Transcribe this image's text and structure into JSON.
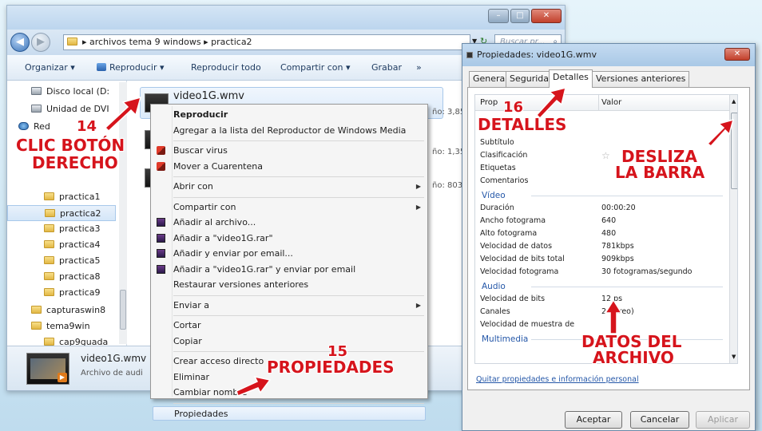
{
  "explorer": {
    "address": [
      "archivos tema 9 windows",
      "practica2"
    ],
    "search_placeholder": "Buscar pr...",
    "toolbar": [
      "Organizar ▾",
      "Reproducir ▾",
      "Reproducir todo",
      "Compartir con ▾",
      "Grabar",
      "»"
    ],
    "nav": [
      {
        "label": "Disco local (D:",
        "indent": 1
      },
      {
        "label": "Unidad de DVI",
        "indent": 1
      },
      {
        "label": "Red",
        "indent": 0
      },
      {
        "label": "practica1",
        "indent": 2
      },
      {
        "label": "practica2",
        "indent": 2,
        "selected": true
      },
      {
        "label": "practica3",
        "indent": 2
      },
      {
        "label": "practica4",
        "indent": 2
      },
      {
        "label": "practica5",
        "indent": 2
      },
      {
        "label": "practica8",
        "indent": 2
      },
      {
        "label": "practica9",
        "indent": 2
      },
      {
        "label": "capturaswin8",
        "indent": 1
      },
      {
        "label": "tema9win",
        "indent": 1
      },
      {
        "label": "cap9guada",
        "indent": 2
      }
    ],
    "files": [
      {
        "name": "video1G.wmv",
        "size": "ño: 3,85"
      },
      {
        "name": "",
        "size": "ño: 1,35"
      },
      {
        "name": "",
        "size": "ño: 803"
      }
    ],
    "details": {
      "name": "video1G.wmv",
      "type": "Archivo de audi"
    }
  },
  "context_menu": {
    "items": [
      {
        "label": "Reproducir",
        "bold": true
      },
      {
        "label": "Agregar a la lista del Reproductor de Windows Media"
      },
      {
        "sep": true
      },
      {
        "label": "Buscar virus",
        "icon": "virus-icon"
      },
      {
        "label": "Mover a Cuarentena",
        "icon": "virus-icon"
      },
      {
        "sep": true
      },
      {
        "label": "Abrir con",
        "submenu": true
      },
      {
        "sep": true
      },
      {
        "label": "Compartir con",
        "submenu": true
      },
      {
        "label": "Añadir al archivo...",
        "icon": "winrar-icon"
      },
      {
        "label": "Añadir a \"video1G.rar\"",
        "icon": "winrar-icon"
      },
      {
        "label": "Añadir y enviar por email...",
        "icon": "winrar-icon"
      },
      {
        "label": "Añadir a \"video1G.rar\" y enviar por email",
        "icon": "winrar-icon"
      },
      {
        "label": "Restaurar versiones anteriores"
      },
      {
        "sep": true
      },
      {
        "label": "Enviar a",
        "submenu": true
      },
      {
        "sep": true
      },
      {
        "label": "Cortar"
      },
      {
        "label": "Copiar"
      },
      {
        "sep": true
      },
      {
        "label": "Crear acceso directo"
      },
      {
        "label": "Eliminar"
      },
      {
        "label": "Cambiar nombre"
      },
      {
        "sep": true
      },
      {
        "label": "Propiedades",
        "highlighted": true
      }
    ]
  },
  "properties": {
    "title": "Propiedades: video1G.wmv",
    "tabs": [
      "General",
      "Seguridad",
      "Detalles",
      "Versiones anteriores"
    ],
    "active_tab": "Detalles",
    "head": {
      "prop": "Prop",
      "value": "Valor"
    },
    "rows": [
      {
        "label": "Subtítulo",
        "value": ""
      },
      {
        "label": "Clasificación",
        "value": "☆"
      },
      {
        "label": "Etiquetas",
        "value": ""
      },
      {
        "label": "Comentarios",
        "value": ""
      },
      {
        "section": "Vídeo"
      },
      {
        "label": "Duración",
        "value": "00:00:20"
      },
      {
        "label": "Ancho fotograma",
        "value": "640"
      },
      {
        "label": "Alto fotograma",
        "value": "480"
      },
      {
        "label": "Velocidad de datos",
        "value": "781kbps"
      },
      {
        "label": "Velocidad de bits total",
        "value": "909kbps"
      },
      {
        "label": "Velocidad fotograma",
        "value": "30 fotogramas/segundo"
      },
      {
        "section": "Audio"
      },
      {
        "label": "Velocidad de bits",
        "value": "12  ps"
      },
      {
        "label": "Canales",
        "value": "2 (  éreo)"
      },
      {
        "label": "Velocidad de muestra de",
        "value": ""
      },
      {
        "section": "Multimedia"
      }
    ],
    "remove_link": "Quitar propiedades e información personal",
    "buttons": [
      "Aceptar",
      "Cancelar",
      "Aplicar"
    ]
  },
  "annotations": {
    "a14_num": "14",
    "a14_l1": "CLIC BOTÓN",
    "a14_l2": "DERECHO",
    "a15_num": "15",
    "a15_label": "PROPIEDADES",
    "a16_num": "16",
    "a16_label": "DETALLES",
    "desliza_l1": "DESLIZA",
    "desliza_l2": "LA BARRA",
    "datos_l1": "DATOS DEL",
    "datos_l2": "ARCHIVO"
  },
  "colors": {
    "annotation": "#d6141c",
    "link": "#2457a8"
  }
}
